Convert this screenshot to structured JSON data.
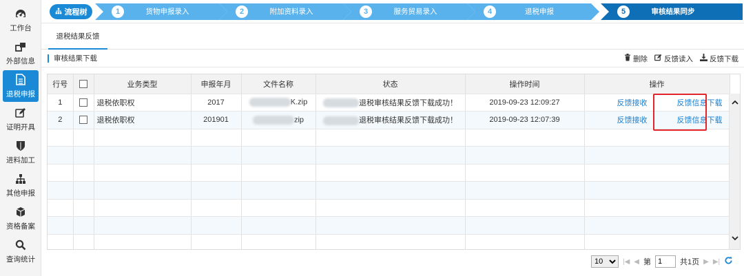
{
  "sidebar": {
    "items": [
      {
        "label": "工作台",
        "icon": "dashboard-icon"
      },
      {
        "label": "外部信息",
        "icon": "external-link-icon"
      },
      {
        "label": "退税申报",
        "icon": "document-icon",
        "active": true
      },
      {
        "label": "证明开具",
        "icon": "edit-icon"
      },
      {
        "label": "进料加工",
        "icon": "shield-icon"
      },
      {
        "label": "其他申报",
        "icon": "sitemap-icon"
      },
      {
        "label": "资格备案",
        "icon": "cube-icon"
      },
      {
        "label": "查询统计",
        "icon": "search-icon"
      }
    ]
  },
  "steps": {
    "flow_label": "流程树",
    "items": [
      {
        "num": "1",
        "label": "货物申报录入"
      },
      {
        "num": "2",
        "label": "附加资料录入"
      },
      {
        "num": "3",
        "label": "服务贸易录入"
      },
      {
        "num": "4",
        "label": "退税申报"
      },
      {
        "num": "5",
        "label": "审核结果同步",
        "current": true
      }
    ]
  },
  "tab": {
    "label": "退税结果反馈"
  },
  "section": {
    "title": "审核结果下载",
    "delete_label": "删除",
    "read_label": "反馈读入",
    "download_label": "反馈下载"
  },
  "table": {
    "headers": [
      "行号",
      "",
      "业务类型",
      "申报年月",
      "文件名称",
      "状态",
      "操作时间",
      "操作"
    ],
    "rows": [
      {
        "no": "1",
        "type": "退税依职权",
        "period": "2017",
        "file_suffix": "K.zip",
        "status": "退税审核结果反馈下载成功！",
        "time": "2019-09-23 12:09:27",
        "op1": "反馈接收",
        "op2": "反馈信息下载"
      },
      {
        "no": "2",
        "type": "退税依职权",
        "period": "201901",
        "file_suffix": "zip",
        "status": "退税审核结果反馈下载成功！",
        "time": "2019-09-23 12:07:39",
        "op1": "反馈接收",
        "op2": "反馈信息下载"
      }
    ]
  },
  "pager": {
    "page_size": "10",
    "page_prefix": "第",
    "page_value": "1",
    "total_label": "共1页"
  },
  "colors": {
    "accent": "#1b8ad6",
    "step_fill": "#59b2ec",
    "step_current": "#0e6fb6",
    "highlight": "#e3242b"
  }
}
